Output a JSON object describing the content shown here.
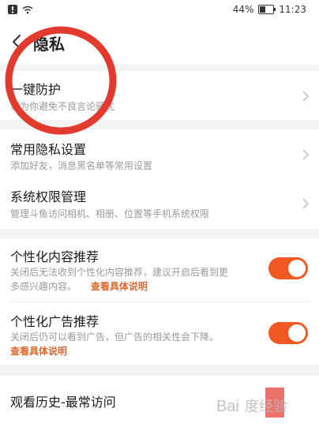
{
  "status_bar": {
    "battery_percent": "44%",
    "time": "11:23",
    "icons": [
      "alert-icon",
      "wifi-icon",
      "battery-icon"
    ]
  },
  "nav": {
    "back_icon": "chevron-left-icon",
    "title": "隐私"
  },
  "sections": {
    "one_key_protection": {
      "title": "一键防护",
      "subtitle": "将为你避免不良言论骚扰"
    },
    "common_privacy": {
      "title": "常用隐私设置",
      "subtitle": "添加好友，消息黑名单等常用设置"
    },
    "system_permissions": {
      "title": "系统权限管理",
      "subtitle": "管理斗鱼访问相机、相册、位置等手机系统权限"
    },
    "personalized_content": {
      "title": "个性化内容推荐",
      "subtitle_line1": "关闭后无法收到个性化内容推荐，建议开启后看到更",
      "subtitle_line2": "多感兴趣内容。",
      "link": "查看具体说明",
      "enabled": true
    },
    "personalized_ads": {
      "title": "个性化广告推荐",
      "subtitle_line1": "关闭后仍可以看到广告，但广告的相关性会下降。",
      "link": "查看具体说明",
      "enabled": true
    },
    "watch_history": {
      "title": "观看历史-最常访问"
    }
  },
  "colors": {
    "accent": "#f05a22",
    "link": "#e0682e",
    "annotation_circle": "#e23a2e",
    "background": "#f3f3f3"
  },
  "watermark": "Bai度经验"
}
